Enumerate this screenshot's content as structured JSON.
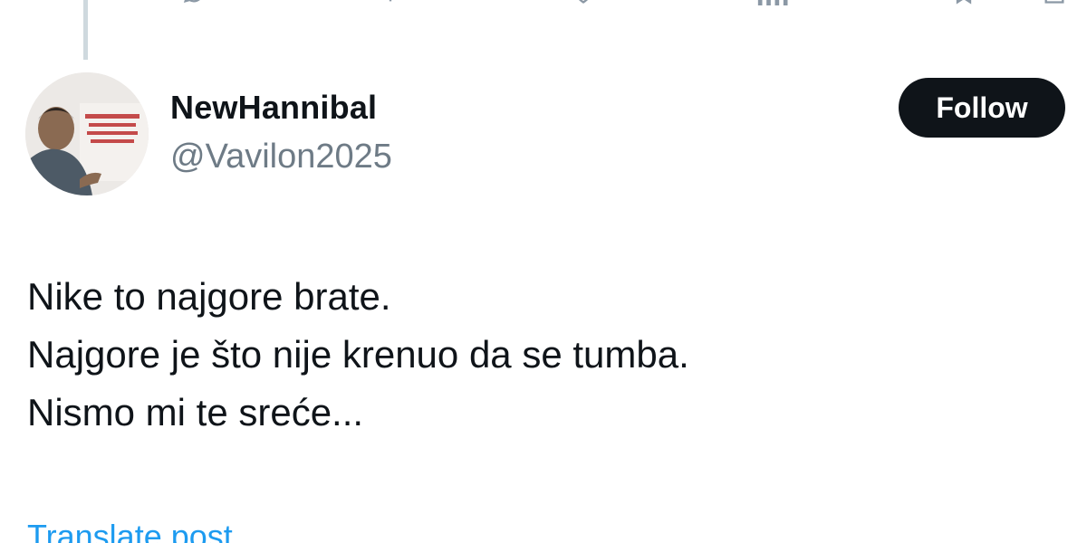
{
  "post": {
    "author": {
      "display_name": "NewHannibal",
      "handle": "@Vavilon2025",
      "avatar_icon": "profile-photo"
    },
    "follow_label": "Follow",
    "text_lines": [
      "Nike to najgore brate.",
      "Najgore je što nije krenuo da se tumba.",
      "Nismo mi te sreće..."
    ],
    "translate_label": "Translate post"
  },
  "top_actions": {
    "icons": [
      "reply-icon",
      "repost-icon",
      "like-icon",
      "views-icon",
      "bookmark-icon",
      "share-icon"
    ]
  },
  "colors": {
    "text_primary": "#0f1419",
    "text_secondary": "#6e7b86",
    "link": "#1d9bf0",
    "button_bg": "#0f1419",
    "thread_line": "#cfd9de"
  }
}
